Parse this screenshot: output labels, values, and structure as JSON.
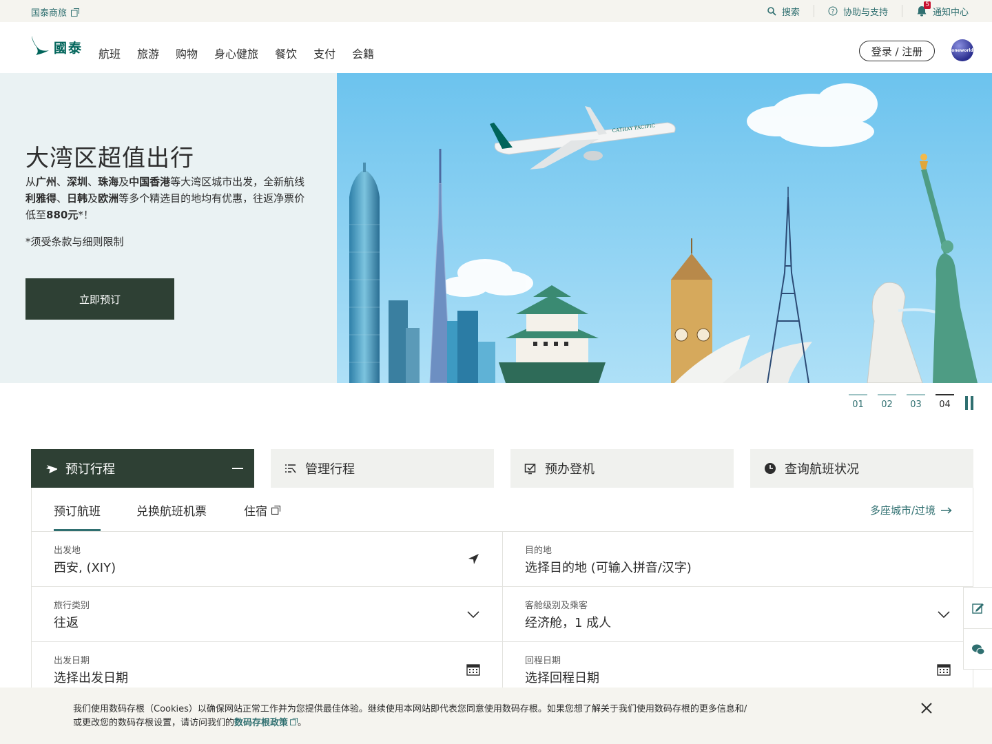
{
  "topbar": {
    "business_link": "国泰商旅",
    "search": "搜索",
    "help": "协助与支持",
    "notifications": "通知中心",
    "notification_count": "5"
  },
  "nav": {
    "logo_text": "國泰",
    "menu": [
      "航班",
      "旅游",
      "购物",
      "身心健旅",
      "餐饮",
      "支付",
      "会籍"
    ],
    "login": "登录 / 注册",
    "oneworld": "oneworld"
  },
  "hero": {
    "title": "大湾区超值出行",
    "desc_parts": [
      {
        "t": "从",
        "b": false
      },
      {
        "t": "广州",
        "b": true
      },
      {
        "t": "、",
        "b": false
      },
      {
        "t": "深圳",
        "b": true
      },
      {
        "t": "、",
        "b": false
      },
      {
        "t": "珠海",
        "b": true
      },
      {
        "t": "及",
        "b": false
      },
      {
        "t": "中国香港",
        "b": true
      },
      {
        "t": "等大湾区城市出发，全新航线",
        "b": false
      },
      {
        "t": "利雅得",
        "b": true
      },
      {
        "t": "、",
        "b": false
      },
      {
        "t": "日韩",
        "b": true
      },
      {
        "t": "及",
        "b": false
      },
      {
        "t": "欧洲",
        "b": true
      },
      {
        "t": "等多个精选目的地均有优惠，往返净票价低至",
        "b": false
      },
      {
        "t": "880元",
        "b": true
      },
      {
        "t": "*！",
        "b": false
      }
    ],
    "note": "*须受条款与细则限制",
    "cta": "立即预订",
    "plane_text": "CATHAY PACIFIC"
  },
  "pager": {
    "pages": [
      "01",
      "02",
      "03",
      "04"
    ],
    "active_index": 3
  },
  "booking_tabs": [
    {
      "label": "预订行程",
      "icon": "plane-icon",
      "active": true
    },
    {
      "label": "管理行程",
      "icon": "list-icon",
      "active": false
    },
    {
      "label": "预办登机",
      "icon": "checkin-icon",
      "active": false
    },
    {
      "label": "查询航班状况",
      "icon": "clock-icon",
      "active": false
    }
  ],
  "subtabs": {
    "book_flight": "预订航班",
    "redeem": "兑换航班机票",
    "hotel": "住宿",
    "multi_city": "多座城市/过境"
  },
  "form": {
    "origin_label": "出发地",
    "origin_value": "西安, (XIY)",
    "destination_label": "目的地",
    "destination_placeholder": "选择目的地 (可输入拼音/汉字)",
    "trip_type_label": "旅行类别",
    "trip_type_value": "往返",
    "cabin_label": "客舱级别及乘客",
    "cabin_value": "经济舱，1 成人",
    "depart_label": "出发日期",
    "depart_placeholder": "选择出发日期",
    "return_label": "回程日期",
    "return_placeholder": "选择回程日期"
  },
  "cookie": {
    "text": "我们使用数码存根（Cookies）以确保网站正常工作并为您提供最佳体验。继续使用本网站即代表您同意使用数码存根。如果您想了解关于我们使用数码存根的更多信息和/或更改您的数码存根设置，请访问我们的",
    "link": "数码存根政策",
    "end": "。"
  },
  "colors": {
    "brand_green": "#00645a",
    "dark_green": "#2e4034",
    "teal_text": "#2f6f70",
    "notice_red": "#c8102e"
  }
}
